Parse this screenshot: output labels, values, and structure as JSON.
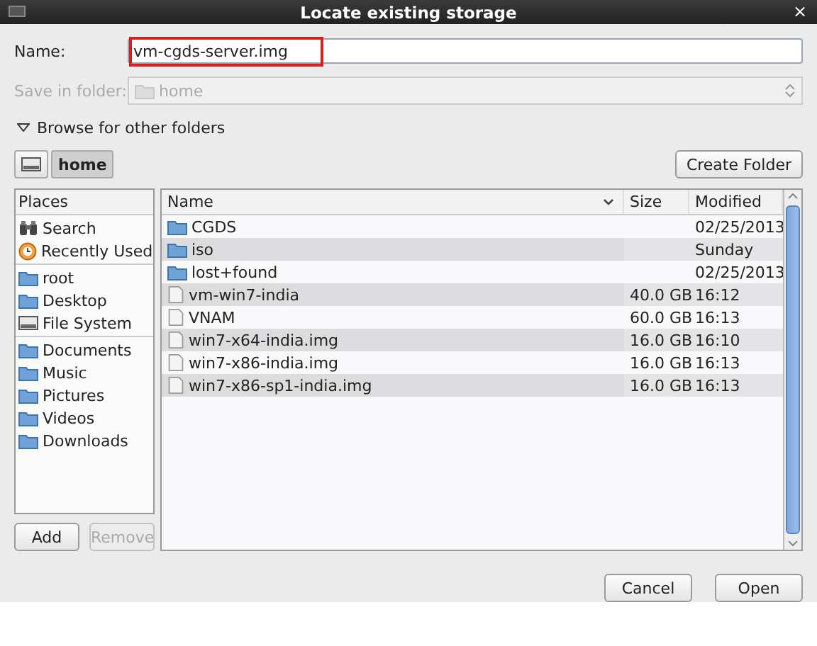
{
  "window": {
    "title": "Locate existing storage",
    "close": "×"
  },
  "name_field": {
    "label": "Name:",
    "value": "vm-cgds-server.img",
    "highlighted": true
  },
  "save_in_folder": {
    "label": "Save in folder:",
    "value": "home",
    "disabled": true
  },
  "browse": {
    "label": "Browse for other folders",
    "expanded": true
  },
  "path_bar": [
    {
      "kind": "drive",
      "selected": false
    },
    {
      "label": "home",
      "selected": true
    }
  ],
  "create_folder_button": "Create Folder",
  "places": {
    "heading": "Places",
    "groups": [
      {
        "items": [
          {
            "kind": "search",
            "label": "Search"
          },
          {
            "kind": "recent",
            "label": "Recently Used"
          }
        ]
      },
      {
        "items": [
          {
            "kind": "folder",
            "label": "root"
          },
          {
            "kind": "folder",
            "label": "Desktop"
          },
          {
            "kind": "drive",
            "label": "File System"
          }
        ]
      },
      {
        "items": [
          {
            "kind": "folder",
            "label": "Documents"
          },
          {
            "kind": "folder",
            "label": "Music"
          },
          {
            "kind": "folder",
            "label": "Pictures"
          },
          {
            "kind": "folder",
            "label": "Videos"
          },
          {
            "kind": "folder",
            "label": "Downloads"
          }
        ]
      }
    ]
  },
  "places_buttons": [
    {
      "label": "Add",
      "disabled": false
    },
    {
      "label": "Remove",
      "disabled": true
    }
  ],
  "table": {
    "columns": [
      "Name",
      "Size",
      "Modified"
    ],
    "rows": [
      {
        "kind": "folder",
        "name": "CGDS",
        "size": "",
        "modified": "02/25/2013"
      },
      {
        "kind": "folder",
        "name": "iso",
        "size": "",
        "modified": "Sunday"
      },
      {
        "kind": "folder",
        "name": "lost+found",
        "size": "",
        "modified": "02/25/2013"
      },
      {
        "kind": "file",
        "name": "vm-win7-india",
        "size": "40.0 GB",
        "modified": "16:12"
      },
      {
        "kind": "file",
        "name": "VNAM",
        "size": "60.0 GB",
        "modified": "16:13"
      },
      {
        "kind": "file",
        "name": "win7-x64-india.img",
        "size": "16.0 GB",
        "modified": "16:10"
      },
      {
        "kind": "file",
        "name": "win7-x86-india.img",
        "size": "16.0 GB",
        "modified": "16:13"
      },
      {
        "kind": "file",
        "name": "win7-x86-sp1-india.img",
        "size": "16.0 GB",
        "modified": "16:13"
      }
    ]
  },
  "buttons": [
    "Cancel",
    "Open"
  ]
}
